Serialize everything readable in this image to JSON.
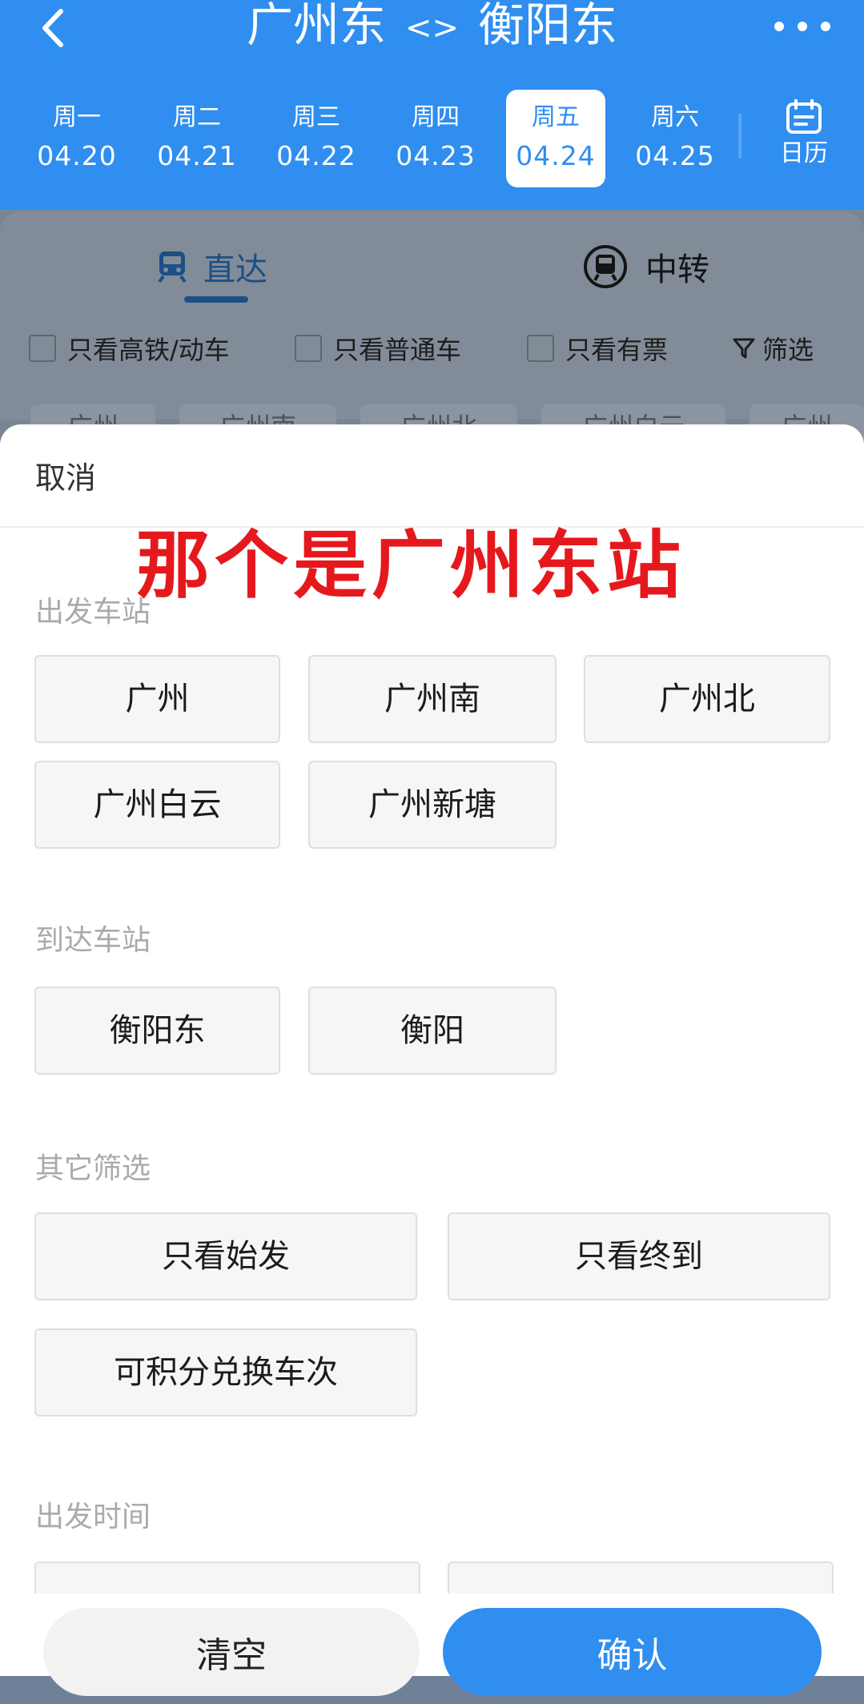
{
  "header": {
    "from": "广州东",
    "swap": "<>",
    "to": "衡阳东",
    "dates": [
      {
        "weekday": "周一",
        "date": "04.20",
        "active": false
      },
      {
        "weekday": "周二",
        "date": "04.21",
        "active": false
      },
      {
        "weekday": "周三",
        "date": "04.22",
        "active": false
      },
      {
        "weekday": "周四",
        "date": "04.23",
        "active": false
      },
      {
        "weekday": "周五",
        "date": "04.24",
        "active": true
      },
      {
        "weekday": "周六",
        "date": "04.25",
        "active": false
      }
    ],
    "calendar_label": "日历"
  },
  "background": {
    "tabs": {
      "direct": "直达",
      "transfer": "中转"
    },
    "filters": {
      "high_speed": "只看高铁/动车",
      "normal": "只看普通车",
      "has_ticket": "只看有票",
      "filter": "筛选"
    },
    "station_chips": [
      "广州",
      "广州南",
      "广州北",
      "广州白云",
      "广州"
    ]
  },
  "sheet": {
    "cancel": "取消",
    "overlay_caption": "那个是广州东站",
    "departure": {
      "title": "出发车站",
      "stations": [
        "广州",
        "广州南",
        "广州北",
        "广州白云",
        "广州新塘"
      ]
    },
    "arrival": {
      "title": "到达车站",
      "stations": [
        "衡阳东",
        "衡阳"
      ]
    },
    "other": {
      "title": "其它筛选",
      "options": [
        "只看始发",
        "只看终到",
        "可积分兑换车次"
      ]
    },
    "time": {
      "title": "出发时间"
    },
    "buttons": {
      "clear": "清空",
      "confirm": "确认"
    }
  },
  "colors": {
    "primary": "#2f8ef0",
    "overlay_red": "#e5191d",
    "chip_bg": "#f5f6f7"
  }
}
